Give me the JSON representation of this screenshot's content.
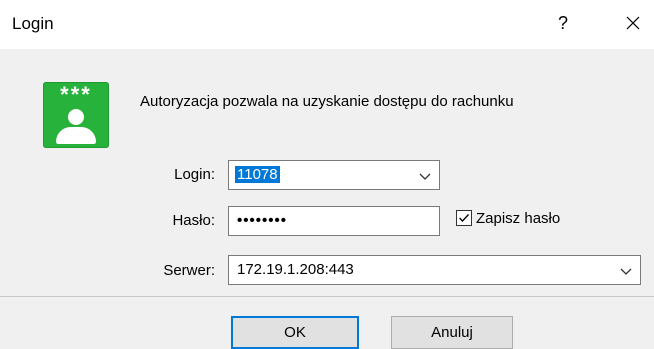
{
  "window": {
    "title": "Login",
    "help_label": "?",
    "close_icon": "close-icon"
  },
  "header": {
    "icon": "user-password-icon",
    "icon_stars": "***",
    "description": "Autoryzacja pozwala na uzyskanie dostępu do rachunku"
  },
  "form": {
    "login": {
      "label": "Login:",
      "value": "11078"
    },
    "password": {
      "label": "Hasło:",
      "value": "••••••••"
    },
    "remember": {
      "label": "Zapisz hasło",
      "checked": true
    },
    "server": {
      "label": "Serwer:",
      "value": "172.19.1.208:443"
    }
  },
  "buttons": {
    "ok": "OK",
    "cancel": "Anuluj"
  },
  "colors": {
    "icon_green": "#27b33b",
    "selection_blue": "#0078d7",
    "dialog_background": "#f0f0f0"
  }
}
